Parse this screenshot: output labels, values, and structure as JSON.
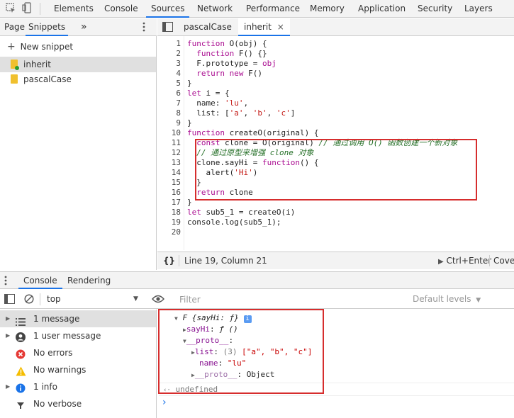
{
  "top_tabs": [
    "Elements",
    "Console",
    "Sources",
    "Network",
    "Performance",
    "Memory",
    "Application",
    "Security",
    "Layers"
  ],
  "active_top_tab": "Sources",
  "left_tabs": [
    "Page",
    "Snippets"
  ],
  "more_tabs": "»",
  "new_snippet": "New snippet",
  "snippets": [
    {
      "name": "inherit"
    },
    {
      "name": "pascalCase"
    }
  ],
  "editor_tabs": [
    "pascalCase",
    "inherit"
  ],
  "editor_tab_close": "×",
  "code": {
    "line_numbers": [
      "1",
      "2",
      "3",
      "4",
      "5",
      "6",
      "7",
      "8",
      "9",
      "10",
      "11",
      "12",
      "13",
      "14",
      "15",
      "16",
      "17",
      "18",
      "19",
      "20"
    ],
    "l1_kw": "function",
    "l1_rest": " O(obj) {",
    "l2_kw": "function",
    "l2_rest": " F() {}",
    "l3_a": "F.prototype = ",
    "l3_b": "obj",
    "l4_kw": "return new",
    "l4_rest": " F()",
    "l5": "}",
    "l6_kw": "let",
    "l6_rest": " i = {",
    "l7_a": "name: ",
    "l7_b": "'lu'",
    "l7_c": ",",
    "l8_a": "list: [",
    "l8_b": "'a'",
    "l8_c": ", ",
    "l8_d": "'b'",
    "l8_e": ", ",
    "l8_f": "'c'",
    "l8_g": "]",
    "l9": "}",
    "l10_kw": "function",
    "l10_rest": " createO(original) {",
    "l11_kw": "const",
    "l11_rest": " clone = O(original)",
    "l11_cm": " // 通过调用 O() 函数创建一个新对象",
    "l12_cm": "// 通过原型来增强 clone 对象",
    "l13_a": "clone.sayHi = ",
    "l13_kw": "function",
    "l13_b": "() {",
    "l14_a": "alert(",
    "l14_b": "'Hi'",
    "l14_c": ")",
    "l15": "}",
    "l16_kw": "return",
    "l16_rest": " clone",
    "l17": "}",
    "l18_kw": "let",
    "l18_rest": " sub5_1 = createO(i)",
    "l19": "console.log(sub5_1);"
  },
  "status": {
    "braces": "{}",
    "position": "Line 19, Column 21",
    "run": "Ctrl+Enter",
    "coverage": "Cover"
  },
  "drawer_tabs": [
    "Console",
    "Rendering"
  ],
  "console_toolbar": {
    "context": "top",
    "filter_placeholder": "Filter",
    "levels": "Default levels"
  },
  "console_sidebar": [
    {
      "label": "1 message"
    },
    {
      "label": "1 user message"
    },
    {
      "label": "No errors"
    },
    {
      "label": "No warnings"
    },
    {
      "label": "1 info"
    },
    {
      "label": "No verbose"
    }
  ],
  "console_output": {
    "obj_head": "F {sayHi: ƒ}",
    "info_badge": "i",
    "sayhi_key": "sayHi",
    "sayhi_val": "ƒ ()",
    "proto_key": "__proto__",
    "list_key": "list",
    "list_len": "(3)",
    "list_val": "[\"a\", \"b\", \"c\"]",
    "name_key": "name",
    "name_val": "\"lu\"",
    "proto2_key": "__proto__",
    "proto2_val": "Object",
    "undefined": "undefined",
    "prompt": "›"
  },
  "colors": {
    "highlight_box": "#d62d2d",
    "active_tab": "#1a73e8",
    "keyword": "#aa0d91",
    "string": "#c41a16",
    "comment": "#236e25"
  }
}
